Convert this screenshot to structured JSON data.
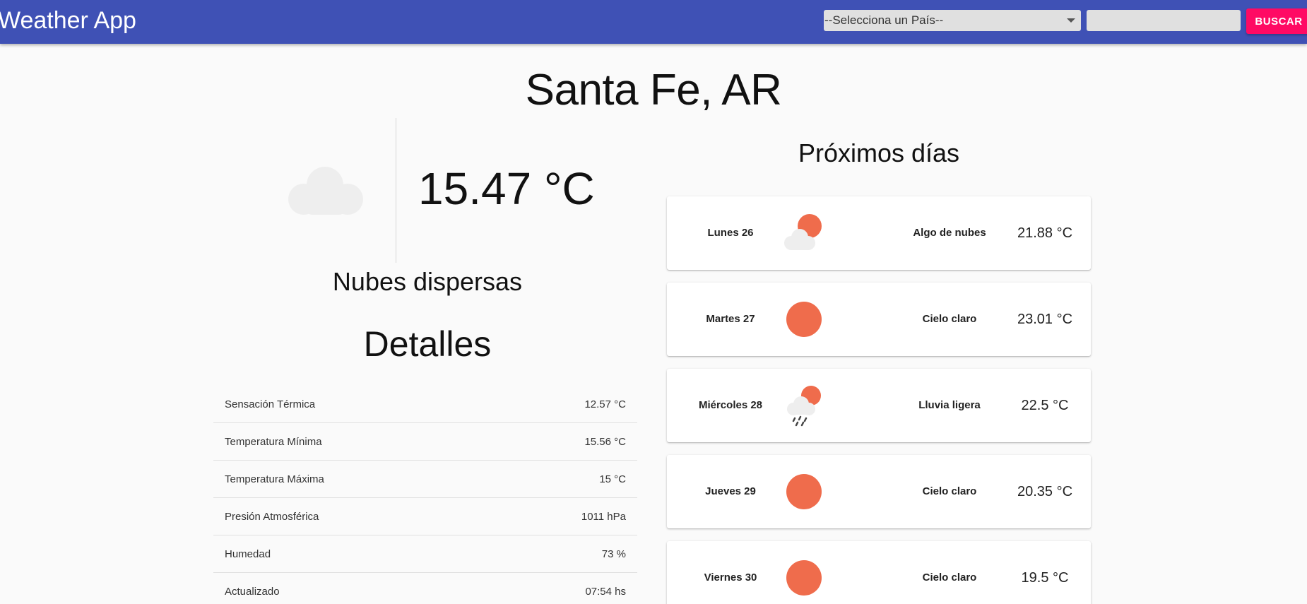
{
  "app": {
    "title": "Weather App"
  },
  "search": {
    "country_placeholder": "--Selecciona un País--",
    "city_value": "",
    "button_label": "BUSCAR"
  },
  "current": {
    "location": "Santa Fe, AR",
    "icon": "cloud-icon",
    "temperature": "15.47 °C",
    "description": "Nubes dispersas"
  },
  "details": {
    "title": "Detalles",
    "rows": [
      {
        "label": "Sensación Térmica",
        "value": "12.57 °C"
      },
      {
        "label": "Temperatura Mínima",
        "value": "15.56 °C"
      },
      {
        "label": "Temperatura Máxima",
        "value": "15 °C"
      },
      {
        "label": "Presión Atmosférica",
        "value": "1011 hPa"
      },
      {
        "label": "Humedad",
        "value": "73 %"
      },
      {
        "label": "Actualizado",
        "value": "07:54 hs"
      }
    ]
  },
  "forecast": {
    "title": "Próximos días",
    "days": [
      {
        "day": "Lunes 26",
        "icon": "partly-cloudy-icon",
        "description": "Algo de nubes",
        "temperature": "21.88 °C"
      },
      {
        "day": "Martes 27",
        "icon": "sun-icon",
        "description": "Cielo claro",
        "temperature": "23.01 °C"
      },
      {
        "day": "Miércoles 28",
        "icon": "light-rain-icon",
        "description": "Lluvia ligera",
        "temperature": "22.5 °C"
      },
      {
        "day": "Jueves 29",
        "icon": "sun-icon",
        "description": "Cielo claro",
        "temperature": "20.35 °C"
      },
      {
        "day": "Viernes 30",
        "icon": "sun-icon",
        "description": "Cielo claro",
        "temperature": "19.5 °C"
      }
    ]
  },
  "colors": {
    "toolbar": "#3f51b5",
    "accent": "#ff0a64",
    "sun": "#ef6c4c",
    "cloud": "#eeeeee"
  }
}
